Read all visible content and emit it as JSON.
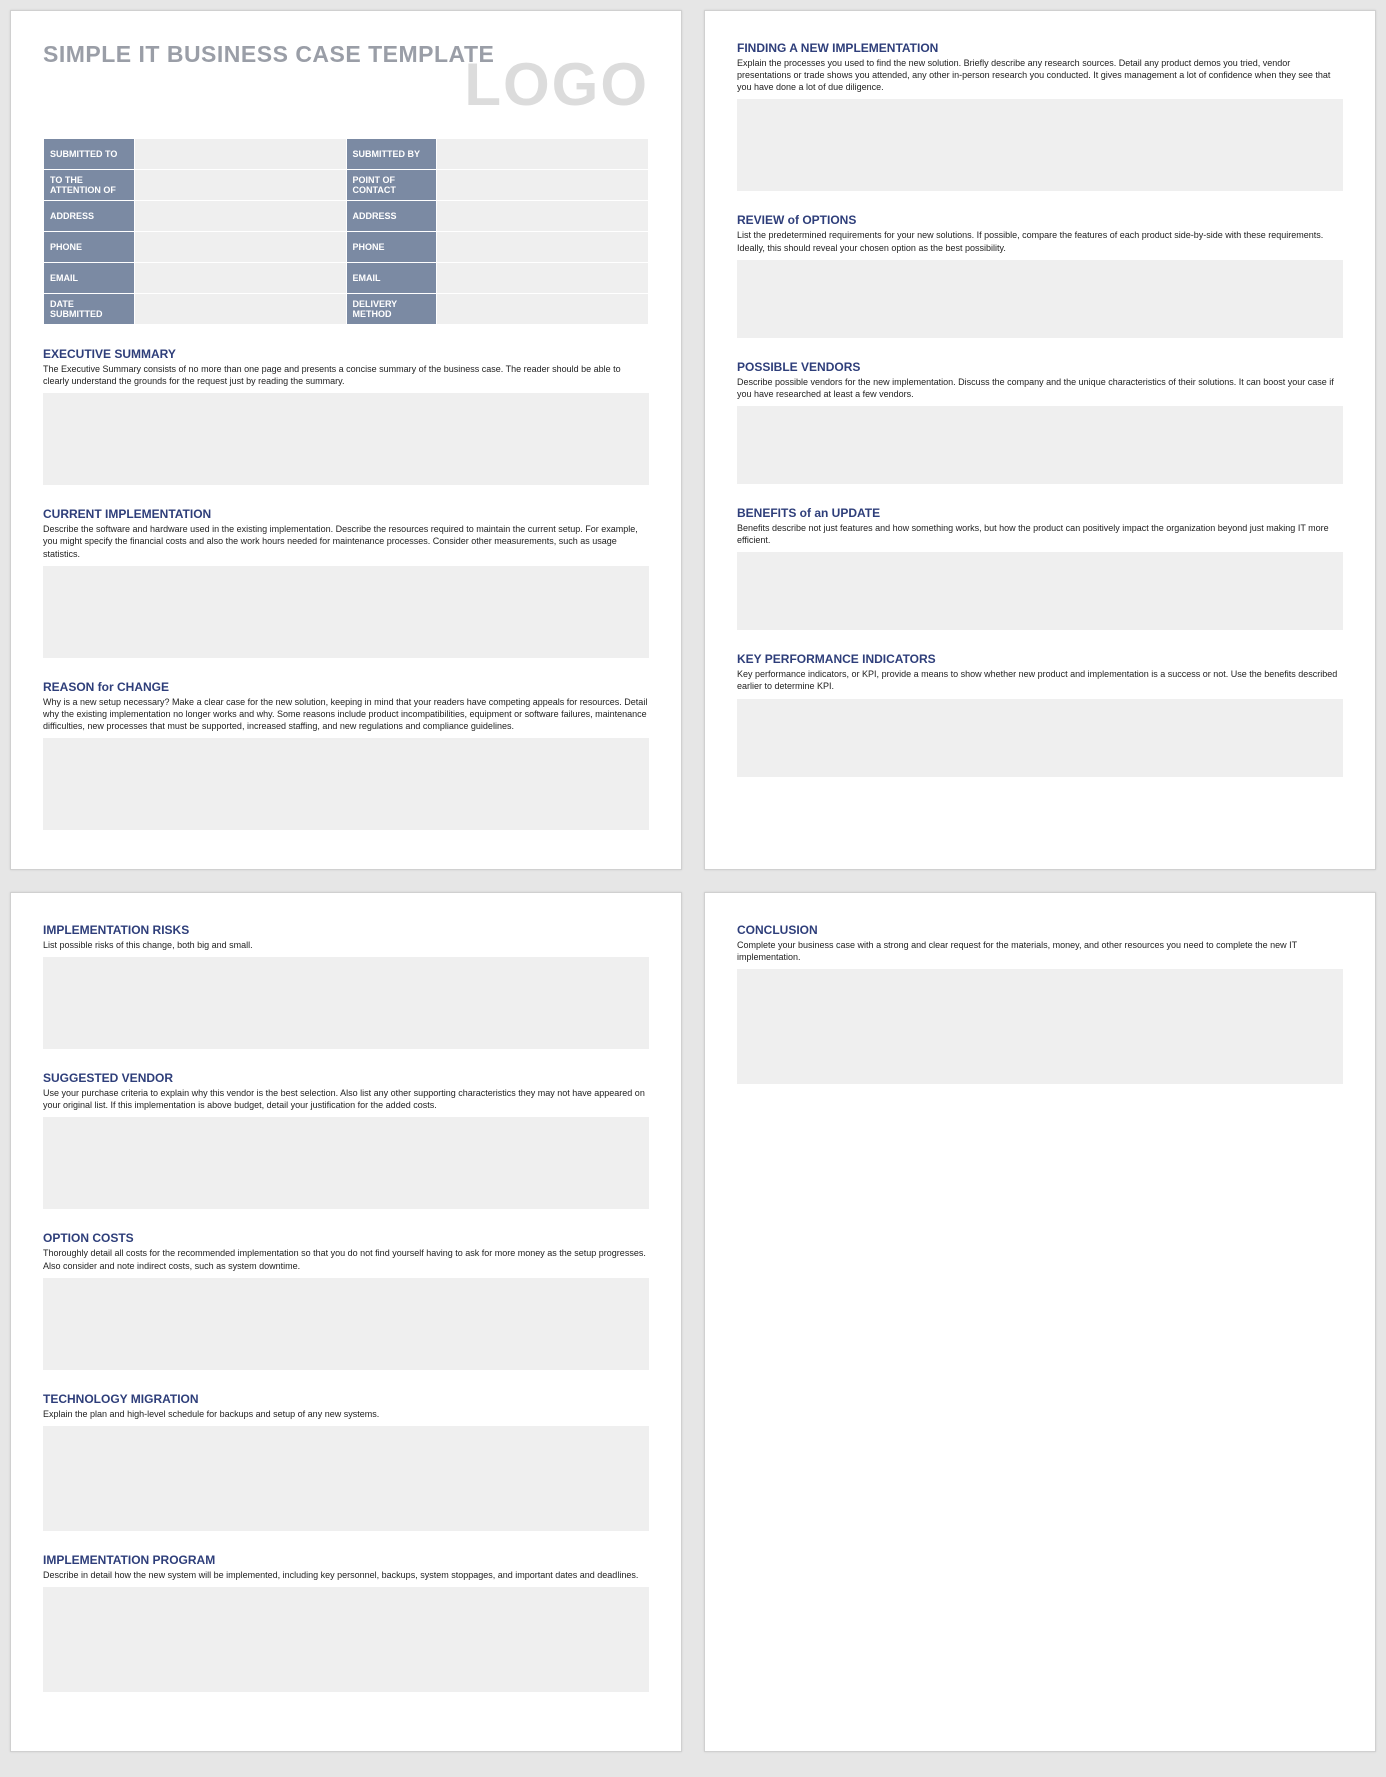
{
  "doc_title": "SIMPLE IT BUSINESS CASE TEMPLATE",
  "logo": "LOGO",
  "fields": {
    "submitted_to": "SUBMITTED TO",
    "submitted_by": "SUBMITTED BY",
    "to_attention": "TO THE ATTENTION OF",
    "point_contact": "POINT OF CONTACT",
    "address_l": "ADDRESS",
    "address_r": "ADDRESS",
    "phone_l": "PHONE",
    "phone_r": "PHONE",
    "email_l": "EMAIL",
    "email_r": "EMAIL",
    "date_submitted": "DATE SUBMITTED",
    "delivery_method": "DELIVERY METHOD"
  },
  "sections": {
    "exec": {
      "title": "EXECUTIVE SUMMARY",
      "desc": "The Executive Summary consists of no more than one page and presents a concise summary of the business case. The reader should be able to clearly understand the grounds for the request just by reading the summary."
    },
    "current": {
      "title": "CURRENT IMPLEMENTATION",
      "desc": "Describe the software and hardware used in the existing implementation. Describe the resources required to maintain the current setup. For example, you might specify the financial costs and also the work hours needed for maintenance processes. Consider other measurements, such as usage statistics."
    },
    "reason": {
      "title": "REASON for CHANGE",
      "desc": "Why is a new setup necessary? Make a clear case for the new solution, keeping in mind that your readers have competing appeals for resources. Detail why the existing implementation no longer works and why. Some reasons include product incompatibilities, equipment or software failures, maintenance difficulties, new processes that must be supported, increased staffing, and new regulations and compliance guidelines."
    },
    "finding": {
      "title": "FINDING A NEW IMPLEMENTATION",
      "desc": "Explain the processes you used to find the new solution. Briefly describe any research sources. Detail any product demos you tried, vendor presentations or trade shows you attended, any other in-person research you conducted. It gives management a lot of confidence when they see that you have done a lot of due diligence."
    },
    "review": {
      "title": "REVIEW of OPTIONS",
      "desc": "List the predetermined requirements for your new solutions. If possible, compare the features of each product side-by-side with these requirements. Ideally, this should reveal your chosen option as the best possibility."
    },
    "vendors": {
      "title": "POSSIBLE VENDORS",
      "desc": "Describe possible vendors for the new implementation. Discuss the company and the unique characteristics of their solutions. It can boost your case if you have researched at least a few vendors."
    },
    "benefits": {
      "title": "BENEFITS of an UPDATE",
      "desc": "Benefits describe not just features and how something works, but how the product can positively impact the organization beyond just making IT more efficient."
    },
    "kpi": {
      "title": "KEY PERFORMANCE INDICATORS",
      "desc": "Key performance indicators, or KPI, provide a means to show whether new product and implementation is a success or not. Use the benefits described earlier to determine KPI."
    },
    "risks": {
      "title": "IMPLEMENTATION RISKS",
      "desc": "List possible risks of this change, both big and small."
    },
    "suggested": {
      "title": "SUGGESTED VENDOR",
      "desc": "Use your purchase criteria to explain why this vendor is the best selection. Also list any other supporting characteristics they may not have appeared on your original list. If this implementation is above budget, detail your justification for the added costs."
    },
    "costs": {
      "title": "OPTION COSTS",
      "desc": "Thoroughly detail all costs for the recommended implementation so that you do not find yourself having to ask for more money as the setup progresses. Also consider and note indirect costs, such as system downtime."
    },
    "migration": {
      "title": "TECHNOLOGY MIGRATION",
      "desc": "Explain the plan and high-level schedule for backups and setup of any new systems."
    },
    "program": {
      "title": "IMPLEMENTATION PROGRAM",
      "desc": "Describe in detail how the new system will be implemented, including key personnel, backups, system stoppages, and important dates and deadlines."
    },
    "conclusion": {
      "title": "CONCLUSION",
      "desc": "Complete your business case with a strong and clear request for the materials, money, and other resources you need to complete the new IT implementation."
    }
  }
}
